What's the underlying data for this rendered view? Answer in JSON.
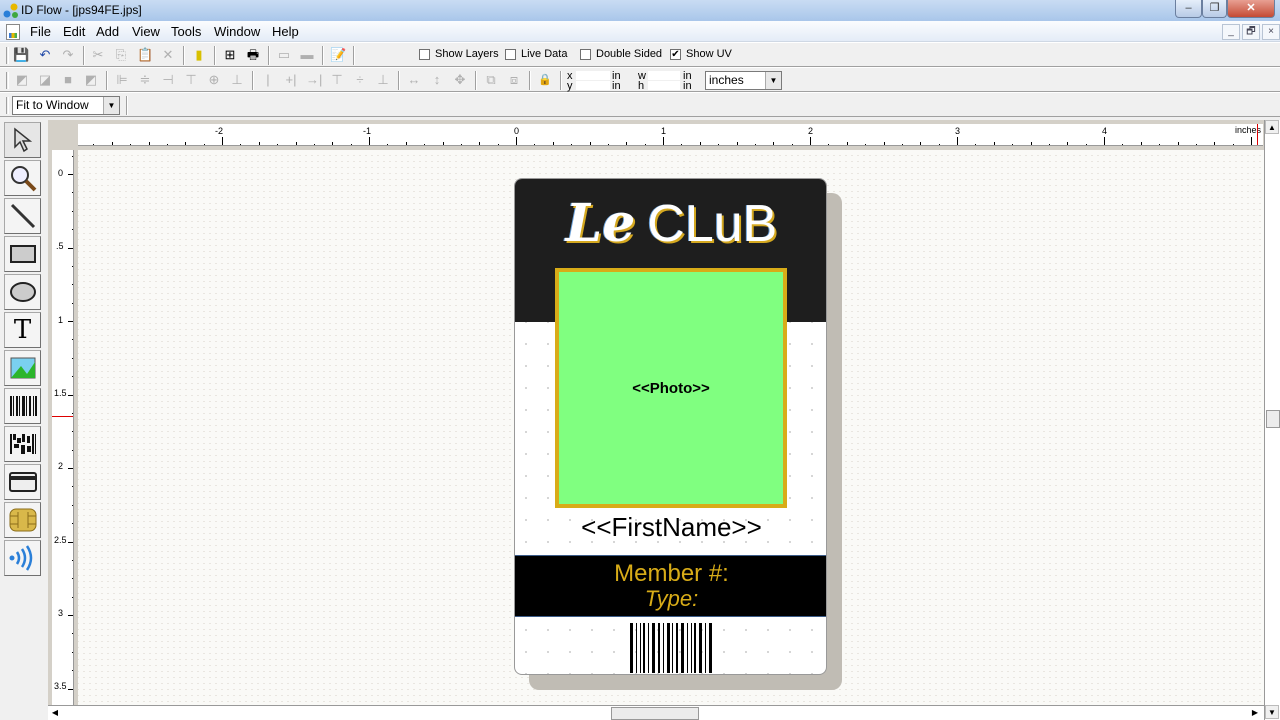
{
  "window": {
    "title": "ID Flow - [jps94FE.jps]",
    "controls": {
      "minimize": "–",
      "restore": "❐",
      "close": "✕"
    }
  },
  "menu": [
    "File",
    "Edit",
    "Add",
    "View",
    "Tools",
    "Window",
    "Help"
  ],
  "mdi_controls": {
    "minimize": "_",
    "restore": "🗗",
    "close": "×"
  },
  "toolbar1": {
    "icons": [
      "save-icon",
      "undo-icon",
      "redo-icon",
      "cut-icon",
      "copy-icon",
      "paste-icon",
      "delete-icon",
      "database-icon",
      "print-layout-icon",
      "print-icon",
      "encode-icon",
      "encode-all-icon",
      "properties-icon"
    ],
    "checkboxes": [
      {
        "label": "Show Layers",
        "checked": false
      },
      {
        "label": "Live Data",
        "checked": false
      },
      {
        "label": "Double Sided",
        "checked": false
      },
      {
        "label": "Show UV",
        "checked": true
      }
    ]
  },
  "toolbar2": {
    "icons": [
      "bring-to-front-icon",
      "bring-forward-icon",
      "send-backward-icon",
      "send-to-back-icon",
      "align-left-icon",
      "align-center-icon",
      "align-right-icon",
      "align-top-icon",
      "align-middle-icon",
      "align-bottom-icon",
      "distribute-left-icon",
      "distribute-center-icon",
      "distribute-right-icon",
      "distribute-top-icon",
      "distribute-middle-icon",
      "distribute-bottom-icon",
      "space-horizontal-icon",
      "space-vertical-icon",
      "space-both-icon",
      "group-icon",
      "ungroup-icon",
      "lock-icon"
    ],
    "coords": {
      "x_label": "x",
      "y_label": "y",
      "w_label": "w",
      "h_label": "h",
      "unit_suffix": "in",
      "x": "",
      "y": "",
      "w": "",
      "h": ""
    },
    "units_select": "inches"
  },
  "toolbar3": {
    "zoom_select": "Fit to Window"
  },
  "tools": [
    "select-pointer-icon",
    "zoom-magnifier-icon",
    "line-tool-icon",
    "rectangle-tool-icon",
    "ellipse-tool-icon",
    "text-tool-icon",
    "image-tool-icon",
    "barcode-tool-icon",
    "2d-barcode-tool-icon",
    "magstripe-tool-icon",
    "smart-chip-tool-icon",
    "rfid-contactless-tool-icon"
  ],
  "rulers": {
    "horizontal_labels": [
      "-2",
      "-1",
      "0",
      "1",
      "2",
      "3",
      "4"
    ],
    "horizontal_unit": "inches",
    "vertical_labels": [
      "0",
      ".5",
      "1",
      "1.5",
      "2",
      "2.5",
      "3",
      "3.5"
    ]
  },
  "card": {
    "title_script": "Le",
    "title_main": "CLuB",
    "photo_placeholder": "<<Photo>>",
    "firstname_placeholder": "<<FirstName>>",
    "member_label": "Member #:",
    "type_label": "Type:",
    "colors": {
      "header": "#1e1e1e",
      "accent_gold": "#d8ac18",
      "photo_fill": "#80ff80",
      "band": "#000000"
    }
  }
}
